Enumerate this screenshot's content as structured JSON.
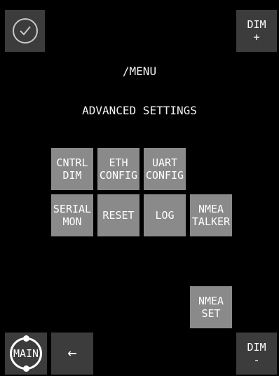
{
  "header": {
    "dim_plus": "DIM\n+",
    "dim_minus": "DIM\n-"
  },
  "path": "/MENU",
  "section_title": "ADVANCED SETTINGS",
  "buttons": {
    "cntrl_dim": "CNTRL\nDIM",
    "eth_config": "ETH\nCONFIG",
    "uart_config": "UART\nCONFIG",
    "serial_mon": "SERIAL\nMON",
    "reset": "RESET",
    "log": "LOG",
    "nmea_talker": "NMEA\nTALKER",
    "nmea_set": "NMEA\nSET"
  },
  "footer": {
    "main": "MAIN",
    "back_arrow": "←"
  },
  "icons": {
    "confirm": "check-icon",
    "back": "arrow-left-icon"
  },
  "colors": {
    "background": "#000000",
    "button": "#8a8a8a",
    "corner_button": "#3c3c3c",
    "text": "#ffffff"
  }
}
